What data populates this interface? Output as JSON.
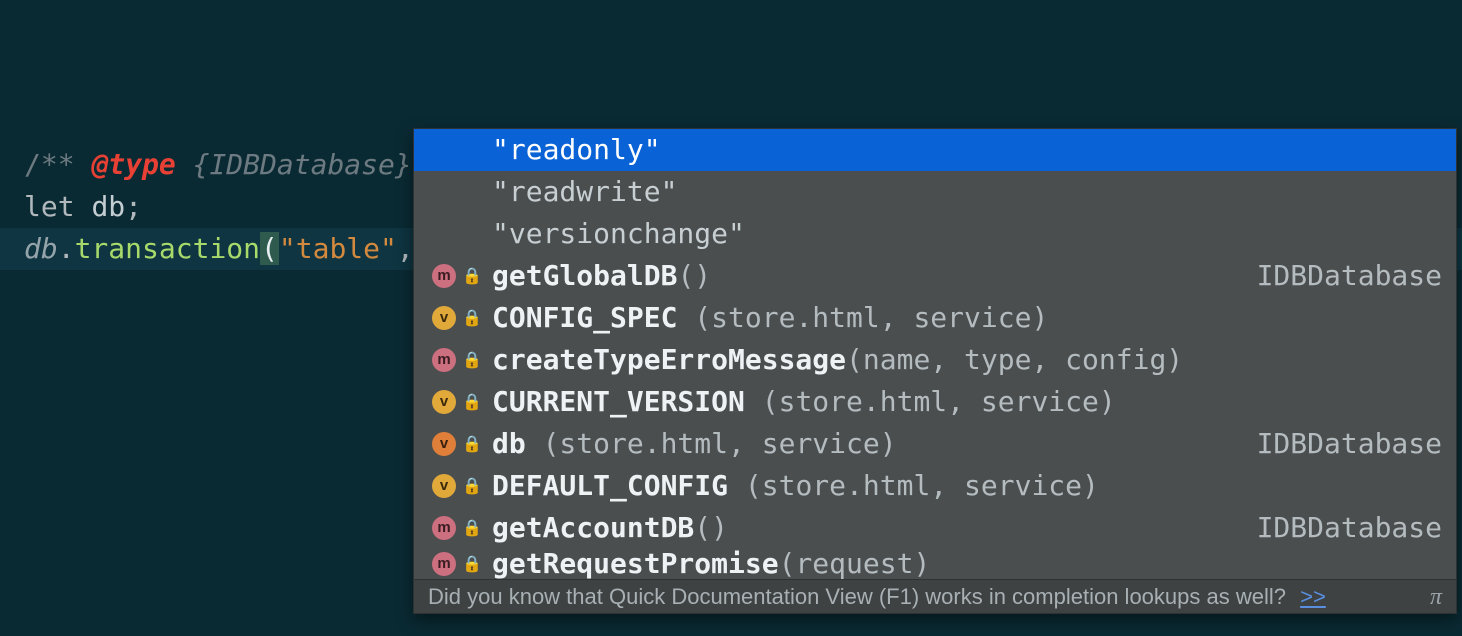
{
  "code": {
    "l1_open": "/** ",
    "l1_tag": "@type",
    "l1_type": " {IDBDatabase} ",
    "l1_close": "*/",
    "l2_let": "let ",
    "l2_id": "db",
    "l2_semi": ";",
    "l3_obj": "db",
    "l3_dot": ".",
    "l3_meth": "transaction",
    "l3_p1": "(",
    "l3_str": "\"table\"",
    "l3_comma": ", ",
    "l3_p2": ")",
    "l3_semi": ";"
  },
  "popup": {
    "items": [
      {
        "kind": "",
        "lock": "",
        "label": "\"readonly\"",
        "args": "",
        "rtype": "",
        "selected": true
      },
      {
        "kind": "",
        "lock": "",
        "label": "\"readwrite\"",
        "args": "",
        "rtype": ""
      },
      {
        "kind": "",
        "lock": "",
        "label": "\"versionchange\"",
        "args": "",
        "rtype": ""
      },
      {
        "kind": "m",
        "lock": "🔒",
        "label": "getGlobalDB",
        "args": "()",
        "rtype": "IDBDatabase"
      },
      {
        "kind": "vy",
        "lock": "🔒",
        "label": "CONFIG_SPEC",
        "args": " (store.html, service)",
        "rtype": ""
      },
      {
        "kind": "m",
        "lock": "🔒",
        "label": "createTypeErroMessage",
        "args": "(name, type, config)",
        "rtype": ""
      },
      {
        "kind": "vy",
        "lock": "🔒",
        "label": "CURRENT_VERSION",
        "args": " (store.html, service)",
        "rtype": ""
      },
      {
        "kind": "v",
        "lock": "🔒",
        "label": "db",
        "args": " (store.html, service)",
        "rtype": "IDBDatabase"
      },
      {
        "kind": "vy",
        "lock": "🔒",
        "label": "DEFAULT_CONFIG",
        "args": " (store.html, service)",
        "rtype": ""
      },
      {
        "kind": "m",
        "lock": "🔒",
        "label": "getAccountDB",
        "args": "()",
        "rtype": "IDBDatabase"
      },
      {
        "kind": "m",
        "lock": "🔒",
        "label": "getRequestPromise",
        "args": "(request)",
        "rtype": "",
        "cut": true
      }
    ],
    "hint_text": "Did you know that Quick Documentation View (F1) works in completion lookups as well? ",
    "hint_link": ">>",
    "pi": "π"
  }
}
